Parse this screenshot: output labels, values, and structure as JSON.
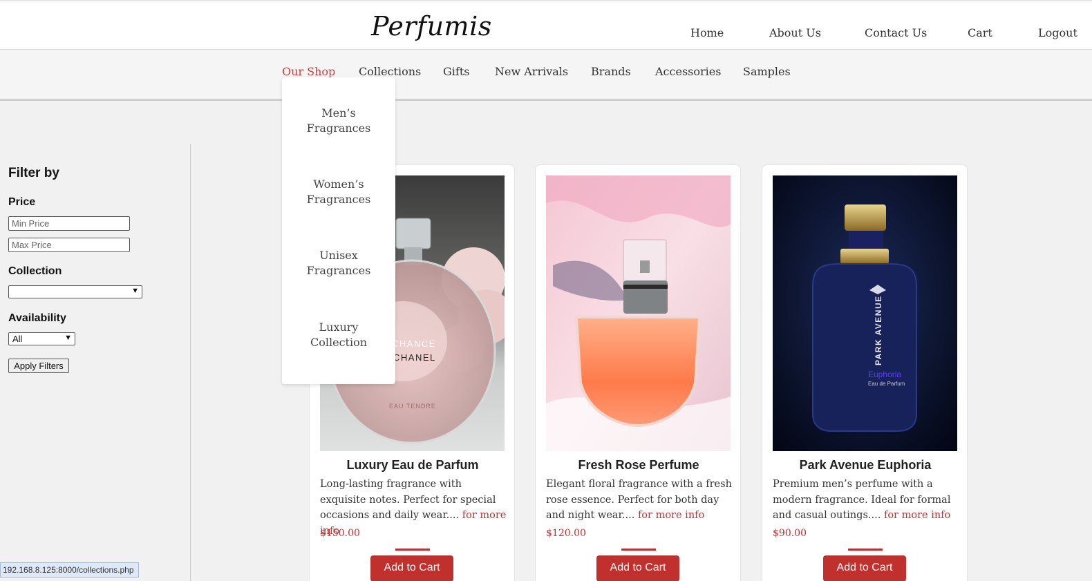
{
  "header": {
    "logo": "Perfumis",
    "nav": [
      "Home",
      "About Us",
      "Contact Us",
      "Cart",
      "Logout"
    ]
  },
  "categories": [
    "Our Shop",
    "Collections",
    "Gifts",
    "New Arrivals",
    "Brands",
    "Accessories",
    "Samples"
  ],
  "dropdown": {
    "items": [
      {
        "line1": "Men’s",
        "line2": "Fragrances"
      },
      {
        "line1": "Women’s",
        "line2": "Fragrances"
      },
      {
        "line1": "Unisex",
        "line2": "Fragrances"
      },
      {
        "line1": "Luxury",
        "line2": "Collection"
      }
    ]
  },
  "filter": {
    "title": "Filter by",
    "price_label": "Price",
    "min_placeholder": "Min Price",
    "max_placeholder": "Max Price",
    "collection_label": "Collection",
    "collection_value": "",
    "availability_label": "Availability",
    "availability_value": "All",
    "apply_label": "Apply Filters"
  },
  "products": [
    {
      "title": "Luxury Eau de Parfum",
      "desc": "Long-lasting fragrance with exquisite notes. Perfect for special occasions and daily wear....",
      "more": "for more info",
      "price": "$150.00",
      "button": "Add to Cart",
      "image_text": {
        "brand1": "CHANCE",
        "brand2": "CHANEL",
        "brand3": "EAU TENDRE"
      }
    },
    {
      "title": "Fresh Rose Perfume",
      "desc": "Elegant floral fragrance with a fresh rose essence. Perfect for both day and night wear....",
      "more": "for more info",
      "price": "$120.00",
      "button": "Add to Cart"
    },
    {
      "title": "Park Avenue Euphoria",
      "desc": "Premium men’s perfume with a modern fragrance. Ideal for formal and casual outings....",
      "more": "for more info",
      "price": "$90.00",
      "button": "Add to Cart",
      "image_text": {
        "brand1": "PARK AVENUE",
        "brand2": "Euphoria",
        "brand3": "Eau de Parfum"
      }
    }
  ],
  "status_url": "192.168.8.125:8000/collections.php",
  "colors": {
    "accent": "#c03030",
    "active_nav": "#d03a3a"
  }
}
